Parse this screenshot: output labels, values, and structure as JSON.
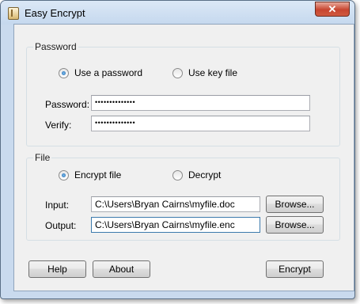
{
  "window": {
    "title": "Easy Encrypt",
    "close_glyph": "✕"
  },
  "password_group": {
    "title": "Password",
    "radio_use_password": "Use a password",
    "radio_use_keyfile": "Use key file",
    "password_label": "Password:",
    "password_value": "••••••••••••••",
    "verify_label": "Verify:",
    "verify_value": "••••••••••••••"
  },
  "file_group": {
    "title": "File",
    "radio_encrypt": "Encrypt file",
    "radio_decrypt": "Decrypt",
    "input_label": "Input:",
    "input_value": "C:\\Users\\Bryan Cairns\\myfile.doc",
    "output_label": "Output:",
    "output_value": "C:\\Users\\Bryan Cairns\\myfile.enc",
    "browse_label": "Browse..."
  },
  "footer": {
    "help_label": "Help",
    "about_label": "About",
    "encrypt_label": "Encrypt"
  }
}
